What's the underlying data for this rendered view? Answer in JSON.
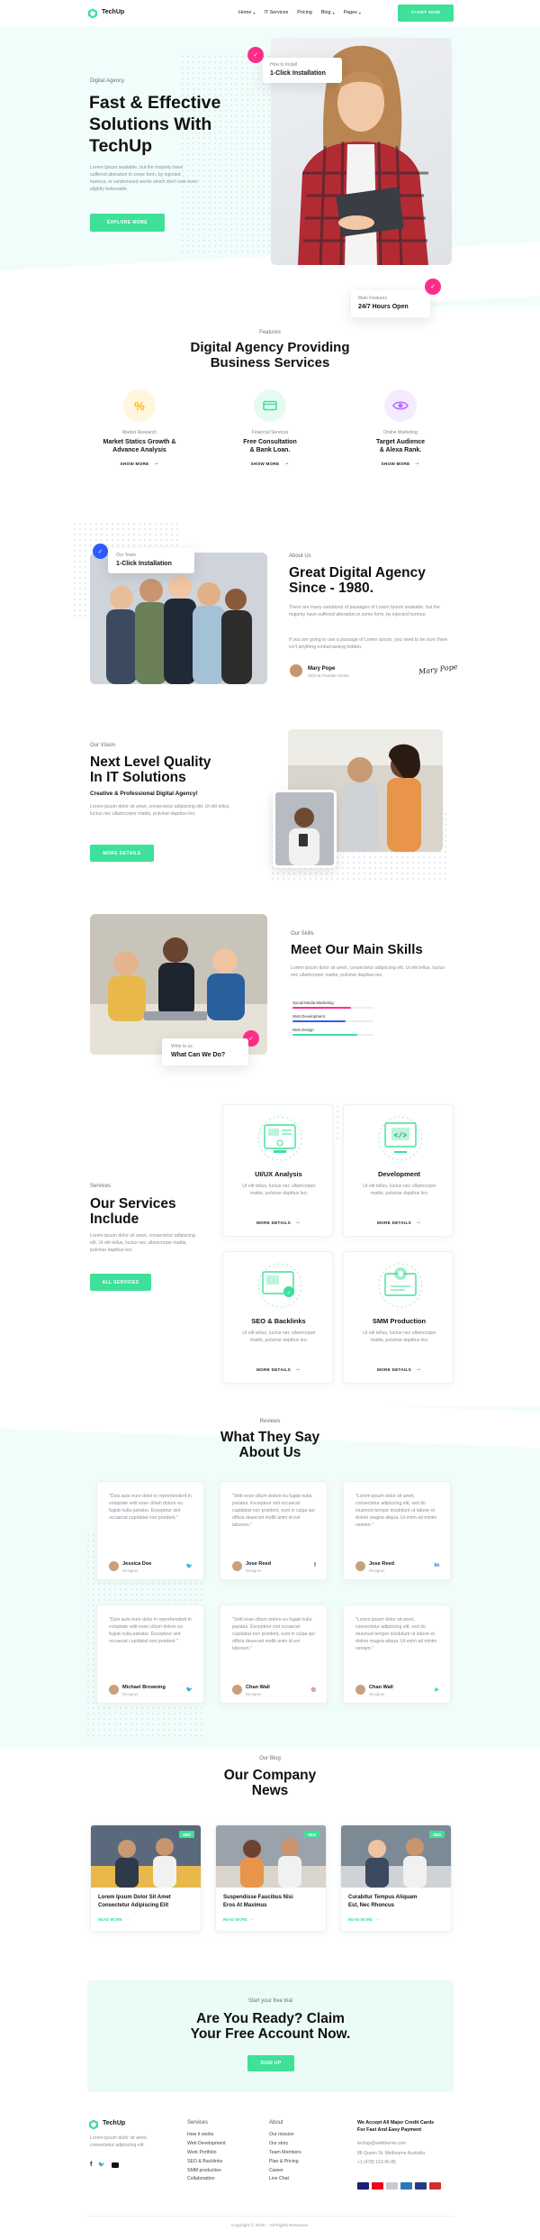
{
  "header": {
    "brand": "TechUp",
    "nav": [
      {
        "label": "Home",
        "has_dropdown": true
      },
      {
        "label": "IT Services",
        "has_dropdown": false
      },
      {
        "label": "Pricing",
        "has_dropdown": false
      },
      {
        "label": "Blog",
        "has_dropdown": true
      },
      {
        "label": "Pages",
        "has_dropdown": true
      }
    ],
    "cta": "START NOW"
  },
  "hero": {
    "eyebrow": "Digital Agency",
    "title_line1": "Fast & Effective",
    "title_line2": "Solutions With",
    "title_line3": "TechUp",
    "description": "Lorem Ipsum available, but the majority have suffered alteration in some form, by injected humour, or randomised words which don't look even slightly believable.",
    "button": "EXPLORE MORE",
    "card_top_small": "How to Install",
    "card_top_big": "1-Click Installation",
    "card_bottom_small": "Main Features",
    "card_bottom_big": "24/7 Hours Open"
  },
  "features": {
    "eyebrow": "Features",
    "title_line1": "Digital Agency Providing",
    "title_line2": "Business Services",
    "items": [
      {
        "icon": "percent-icon",
        "color": "#ffb800",
        "tag": "Market Research",
        "title_line1": "Market Statics Growth &",
        "title_line2": "Advance Analysis",
        "link": "SHOW MORE"
      },
      {
        "icon": "card-icon",
        "color": "#3ee09a",
        "tag": "Financial Services",
        "title_line1": "Free Consultation",
        "title_line2": "& Bank Loan.",
        "link": "SHOW MORE"
      },
      {
        "icon": "eye-icon",
        "color": "#b56cff",
        "tag": "Online Marketing",
        "title_line1": "Target Audience",
        "title_line2": "& Alexa Rank.",
        "link": "SHOW MORE"
      }
    ]
  },
  "about": {
    "card_small": "Our Team",
    "card_big": "1-Click Installation",
    "eyebrow": "About Us",
    "title_line1": "Great Digital Agency",
    "title_line2": "Since - 1980.",
    "para1": "There are many variations of passages of Lorem Ipsum available, but the majority have suffered alteration in some form, by injected humour.",
    "para2": "If you are going to use a passage of Lorem Ipsum, you need to be sure there isn't anything embarrassing hidden.",
    "person_name": "Mary Pope",
    "person_role": "CEO & Founder Nicole",
    "signature": "Mary Pope"
  },
  "vision": {
    "eyebrow": "Our Vision",
    "title_line1": "Next Level Quality",
    "title_line2": "In IT Solutions",
    "subtitle": "Creative & Professional Digital Agency!",
    "description": "Lorem ipsum dolor sit amet, consectetur adipiscing elit. Ut elit tellus, luctus nec ullamcorper mattis, pulvinar dapibus leo.",
    "button": "MORE DETAILS"
  },
  "skills": {
    "card_small": "Write to us",
    "card_big": "What Can We Do?",
    "eyebrow": "Our Skills",
    "title": "Meet Our Main Skills",
    "description": "Lorem ipsum dolor sit amet, consectetur adipiscing elit. Ut elit tellus, luctus nec ullamcorper mattis, pulvinar dapibus leo.",
    "bars": [
      {
        "label": "Social Media Marketing",
        "value": 0.72,
        "color": "#ff2d8a"
      },
      {
        "label": "Web Development",
        "value": 0.66,
        "color": "#2d5bff"
      },
      {
        "label": "Web Design",
        "value": 0.8,
        "color": "#3ee09a"
      }
    ]
  },
  "services": {
    "eyebrow": "Services",
    "title_line1": "Our Services",
    "title_line2": "Include",
    "description": "Lorem ipsum dolor sit amet, consectetur adipiscing elit. Ut elit tellus, luctus nec ullamcorper mattis, pulvinar dapibus leo.",
    "button": "ALL SERVICES",
    "items": [
      {
        "icon": "ui-ux-icon",
        "title": "UI/UX Analysis",
        "text": "Ut elit tellus, luctus nec ullamcorper mattis, pulvinar dapibus leo.",
        "link": "MORE DETAILS"
      },
      {
        "icon": "code-icon",
        "title": "Development",
        "text": "Ut elit tellus, luctus nec ullamcorper mattis, pulvinar dapibus leo.",
        "link": "MORE DETAILS"
      },
      {
        "icon": "seo-icon",
        "title": "SEO & Backlinks",
        "text": "Ut elit tellus, luctus nec ullamcorper mattis, pulvinar dapibus leo.",
        "link": "MORE DETAILS"
      },
      {
        "icon": "smm-icon",
        "title": "SMM Production",
        "text": "Ut elit tellus, luctus nec ullamcorper mattis, pulvinar dapibus leo.",
        "link": "MORE DETAILS"
      }
    ]
  },
  "reviews": {
    "eyebrow": "Reviews",
    "title_line1": "What They Say",
    "title_line2": "About Us",
    "items": [
      {
        "quote": "\"Duis aute irure dolor in reprehenderit in voluptate velit esse cillum dolore eu fugiat nulla pariatur. Excepteur sint occaecat cupidatat non proident.\"",
        "name": "Jessica Doe",
        "role": "Designer",
        "social": "twitter-icon",
        "social_color": "#1da1f2"
      },
      {
        "quote": "\"Velit esse cillum dolore eu fugiat nulla pariatur. Excepteur sint occaecat cupidatat non proident, sunt in culpa qui officia deserunt mollit anim id est laborum.\"",
        "name": "Jose Reed",
        "role": "Designer",
        "social": "facebook-icon",
        "social_color": "#3b5998"
      },
      {
        "quote": "\"Lorem ipsum dolor sit amet, consectetur adipiscing elit, sed do eiusmod tempor incididunt ut labore et dolore magna aliqua. Ut enim ad minim veniam.\"",
        "name": "Jose Reed",
        "role": "Designer",
        "social": "linkedin-icon",
        "social_color": "#0a66c2"
      },
      {
        "quote": "\"Duis aute irure dolor in reprehenderit in voluptate velit esse cillum dolore eu fugiat nulla pariatur. Excepteur sint occaecat cupidatat non proident.\"",
        "name": "Michael Browning",
        "role": "Designer",
        "social": "twitter-icon",
        "social_color": "#1da1f2"
      },
      {
        "quote": "\"Velit esse cillum dolore eu fugiat nulla pariatur. Excepteur sint occaecat cupidatat non proident, sunt in culpa qui officia deserunt mollit anim id est laborum.\"",
        "name": "Chan Wall",
        "role": "Designer",
        "social": "instagram-icon",
        "social_color": "#c13584"
      },
      {
        "quote": "\"Lorem ipsum dolor sit amet, consectetur adipiscing elit, sed do eiusmod tempor incididunt ut labore et dolore magna aliqua. Ut enim ad minim veniam.\"",
        "name": "Chan Wall",
        "role": "Designer",
        "social": "youtube-icon",
        "social_color": "#3ee09a"
      }
    ]
  },
  "blog": {
    "eyebrow": "Our Blog",
    "title_line1": "Our Company",
    "title_line2": "News",
    "posts": [
      {
        "tag": "SEO",
        "title_line1": "Lorem Ipsum Dolor Sit Amet",
        "title_line2": "Consectetur Adipiscing Elit",
        "link": "READ MORE"
      },
      {
        "tag": "SEO",
        "title_line1": "Suspendisse Faucibus Nisi",
        "title_line2": "Eros At Maximus",
        "link": "READ MORE"
      },
      {
        "tag": "SEO",
        "title_line1": "Curabitur Tempus Aliquam",
        "title_line2": "Est, Nec Rhoncus",
        "link": "READ MORE"
      }
    ]
  },
  "cta": {
    "eyebrow": "Start your free trial",
    "title_line1": "Are You Ready? Claim",
    "title_line2": "Your Free Account Now.",
    "button": "SIGN UP"
  },
  "footer": {
    "brand": "TechUp",
    "tagline": "Lorem ipsum dolor sit amet, consectetur adipiscing elit.",
    "services_title": "Services",
    "services": [
      "How it works",
      "Web Development",
      "Work Portfolio",
      "SEO & Backlinks",
      "SMM production",
      "Collaboration"
    ],
    "about_title": "About",
    "about": [
      "Our mission",
      "Our story",
      "Team Members",
      "Plan & Pricing",
      "Career",
      "Live Chat"
    ],
    "payment_title_line1": "We Accept All Major Credit Cards",
    "payment_title_line2": "For Fast And Easy Payment",
    "email": "techup@webtheme.com",
    "address": "88 Queen St. Melbourne Australia",
    "phone": "+1 (478) 123-45-85",
    "copyright": "Copyright © 2020. - All Rights Reserved."
  }
}
